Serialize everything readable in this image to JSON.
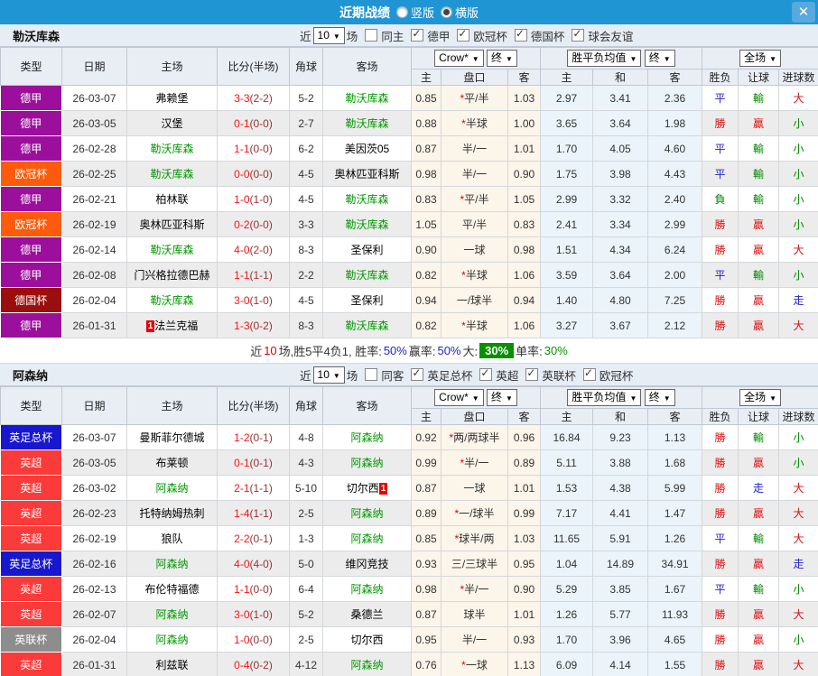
{
  "titlebar": {
    "title": "近期战绩",
    "vertical": "竖版",
    "horizontal": "横版",
    "selected": "horizontal",
    "close": "✕"
  },
  "table_header": {
    "type": "类型",
    "date": "日期",
    "home": "主场",
    "score": "比分(半场)",
    "corners": "角球",
    "away": "客场",
    "book": "Crow*",
    "final": "终",
    "h": "主",
    "pan": "盘口",
    "a": "客",
    "avg": "胜平负均值",
    "avg_final": "终",
    "avg_h": "主",
    "avg_d": "和",
    "avg_a": "客",
    "scope": "全场",
    "result": "胜负",
    "handicap": "让球",
    "goals": "进球数"
  },
  "colors": {
    "titlebar": "#2095d3",
    "red": "#dd1111",
    "green": "#008800",
    "blue": "#2222cc",
    "ft": "#ff1111",
    "ht": "#993333",
    "team": "#009900",
    "league": {
      "德甲": "#9c0f9c",
      "欧冠杯": "#fd5b0b",
      "德国杯": "#9b0e0e",
      "英足总杯": "#1717cf",
      "英超": "#fb3a3a",
      "英联杯": "#8d8d8d"
    }
  },
  "result_colors": {
    "勝": "red",
    "贏": "red",
    "大": "red",
    "平": "blue",
    "走": "blue",
    "負": "green",
    "輸": "green",
    "小": "green"
  },
  "sections": [
    {
      "team": "勒沃库森",
      "filter": {
        "near": "近",
        "count": "10",
        "games": "场",
        "same": {
          "label": "同主",
          "checked": false
        },
        "leagues": [
          {
            "label": "德甲",
            "checked": true
          },
          {
            "label": "欧冠杯",
            "checked": true
          },
          {
            "label": "德国杯",
            "checked": true
          },
          {
            "label": "球会友谊",
            "checked": true
          }
        ]
      },
      "rows": [
        {
          "type": "德甲",
          "date": "26-03-07",
          "home": "弗赖堡",
          "home_team": false,
          "ft": "3-3",
          "ht": "(2-2)",
          "corners": "5-2",
          "away": "勒沃库森",
          "away_team": true,
          "o1": "0.85",
          "pan": "*平/半",
          "o2": "1.03",
          "a1": "2.97",
          "a2": "3.41",
          "a3": "2.36",
          "r1": "平",
          "r2": "輸",
          "r3": "大"
        },
        {
          "type": "德甲",
          "date": "26-03-05",
          "home": "汉堡",
          "home_team": false,
          "ft": "0-1",
          "ht": "(0-0)",
          "corners": "2-7",
          "away": "勒沃库森",
          "away_team": true,
          "o1": "0.88",
          "pan": "*半球",
          "o2": "1.00",
          "a1": "3.65",
          "a2": "3.64",
          "a3": "1.98",
          "r1": "勝",
          "r2": "贏",
          "r3": "小"
        },
        {
          "type": "德甲",
          "date": "26-02-28",
          "home": "勒沃库森",
          "home_team": true,
          "ft": "1-1",
          "ht": "(0-0)",
          "corners": "6-2",
          "away": "美因茨05",
          "away_team": false,
          "o1": "0.87",
          "pan": "半/一",
          "o2": "1.01",
          "a1": "1.70",
          "a2": "4.05",
          "a3": "4.60",
          "r1": "平",
          "r2": "輸",
          "r3": "小"
        },
        {
          "type": "欧冠杯",
          "date": "26-02-25",
          "home": "勒沃库森",
          "home_team": true,
          "ft": "0-0",
          "ht": "(0-0)",
          "corners": "4-5",
          "away": "奥林匹亚科斯",
          "away_team": false,
          "o1": "0.98",
          "pan": "半/一",
          "o2": "0.90",
          "a1": "1.75",
          "a2": "3.98",
          "a3": "4.43",
          "r1": "平",
          "r2": "輸",
          "r3": "小"
        },
        {
          "type": "德甲",
          "date": "26-02-21",
          "home": "柏林联",
          "home_team": false,
          "ft": "1-0",
          "ht": "(1-0)",
          "corners": "4-5",
          "away": "勒沃库森",
          "away_team": true,
          "o1": "0.83",
          "pan": "*平/半",
          "o2": "1.05",
          "a1": "2.99",
          "a2": "3.32",
          "a3": "2.40",
          "r1": "負",
          "r2": "輸",
          "r3": "小"
        },
        {
          "type": "欧冠杯",
          "date": "26-02-19",
          "home": "奥林匹亚科斯",
          "home_team": false,
          "ft": "0-2",
          "ht": "(0-0)",
          "corners": "3-3",
          "away": "勒沃库森",
          "away_team": true,
          "o1": "1.05",
          "pan": "平/半",
          "o2": "0.83",
          "a1": "2.41",
          "a2": "3.34",
          "a3": "2.99",
          "r1": "勝",
          "r2": "贏",
          "r3": "小"
        },
        {
          "type": "德甲",
          "date": "26-02-14",
          "home": "勒沃库森",
          "home_team": true,
          "ft": "4-0",
          "ht": "(2-0)",
          "corners": "8-3",
          "away": "圣保利",
          "away_team": false,
          "o1": "0.90",
          "pan": "一球",
          "o2": "0.98",
          "a1": "1.51",
          "a2": "4.34",
          "a3": "6.24",
          "r1": "勝",
          "r2": "贏",
          "r3": "大"
        },
        {
          "type": "德甲",
          "date": "26-02-08",
          "home": "门兴格拉德巴赫",
          "home_team": false,
          "ft": "1-1",
          "ht": "(1-1)",
          "corners": "2-2",
          "away": "勒沃库森",
          "away_team": true,
          "o1": "0.82",
          "pan": "*半球",
          "o2": "1.06",
          "a1": "3.59",
          "a2": "3.64",
          "a3": "2.00",
          "r1": "平",
          "r2": "輸",
          "r3": "小"
        },
        {
          "type": "德国杯",
          "date": "26-02-04",
          "home": "勒沃库森",
          "home_team": true,
          "ft": "3-0",
          "ht": "(1-0)",
          "corners": "4-5",
          "away": "圣保利",
          "away_team": false,
          "o1": "0.94",
          "pan": "一/球半",
          "o2": "0.94",
          "a1": "1.40",
          "a2": "4.80",
          "a3": "7.25",
          "r1": "勝",
          "r2": "贏",
          "r3": "走"
        },
        {
          "type": "德甲",
          "date": "26-01-31",
          "home": "法兰克福",
          "home_team": false,
          "home_rank": "1",
          "home_rank_pos": "before",
          "ft": "1-3",
          "ht": "(0-2)",
          "corners": "8-3",
          "away": "勒沃库森",
          "away_team": true,
          "o1": "0.82",
          "pan": "*半球",
          "o2": "1.06",
          "a1": "3.27",
          "a2": "3.67",
          "a3": "2.12",
          "r1": "勝",
          "r2": "贏",
          "r3": "大"
        }
      ],
      "summary_parts": [
        {
          "t": "近",
          "c": "dark"
        },
        {
          "t": "10",
          "c": "red"
        },
        {
          "t": "场,胜5平4负1, 胜率:",
          "c": "dark"
        },
        {
          "t": "50%",
          "c": "blue"
        },
        {
          "t": " 赢率:",
          "c": "dark"
        },
        {
          "t": "50%",
          "c": "blue"
        },
        {
          "t": " 大: ",
          "c": "dark"
        },
        {
          "t": "30%",
          "c": "bigbox"
        },
        {
          "t": " 单率:",
          "c": "dark"
        },
        {
          "t": "30%",
          "c": "green"
        }
      ]
    },
    {
      "team": "阿森纳",
      "filter": {
        "near": "近",
        "count": "10",
        "games": "场",
        "same": {
          "label": "同客",
          "checked": false
        },
        "leagues": [
          {
            "label": "英足总杯",
            "checked": true
          },
          {
            "label": "英超",
            "checked": true
          },
          {
            "label": "英联杯",
            "checked": true
          },
          {
            "label": "欧冠杯",
            "checked": true
          }
        ]
      },
      "rows": [
        {
          "type": "英足总杯",
          "date": "26-03-07",
          "home": "曼斯菲尔德城",
          "home_team": false,
          "ft": "1-2",
          "ht": "(0-1)",
          "corners": "4-8",
          "away": "阿森纳",
          "away_team": true,
          "o1": "0.92",
          "pan": "*两/两球半",
          "o2": "0.96",
          "a1": "16.84",
          "a2": "9.23",
          "a3": "1.13",
          "r1": "勝",
          "r2": "輸",
          "r3": "小"
        },
        {
          "type": "英超",
          "date": "26-03-05",
          "home": "布莱顿",
          "home_team": false,
          "ft": "0-1",
          "ht": "(0-1)",
          "corners": "4-3",
          "away": "阿森纳",
          "away_team": true,
          "o1": "0.99",
          "pan": "*半/一",
          "o2": "0.89",
          "a1": "5.11",
          "a2": "3.88",
          "a3": "1.68",
          "r1": "勝",
          "r2": "贏",
          "r3": "小"
        },
        {
          "type": "英超",
          "date": "26-03-02",
          "home": "阿森纳",
          "home_team": true,
          "ft": "2-1",
          "ht": "(1-1)",
          "corners": "5-10",
          "away": "切尔西",
          "away_team": false,
          "away_rank": "1",
          "away_rank_pos": "after",
          "o1": "0.87",
          "pan": "一球",
          "o2": "1.01",
          "a1": "1.53",
          "a2": "4.38",
          "a3": "5.99",
          "r1": "勝",
          "r2": "走",
          "r3": "大"
        },
        {
          "type": "英超",
          "date": "26-02-23",
          "home": "托特纳姆热刺",
          "home_team": false,
          "ft": "1-4",
          "ht": "(1-1)",
          "corners": "2-5",
          "away": "阿森纳",
          "away_team": true,
          "o1": "0.89",
          "pan": "*一/球半",
          "o2": "0.99",
          "a1": "7.17",
          "a2": "4.41",
          "a3": "1.47",
          "r1": "勝",
          "r2": "贏",
          "r3": "大"
        },
        {
          "type": "英超",
          "date": "26-02-19",
          "home": "狼队",
          "home_team": false,
          "ft": "2-2",
          "ht": "(0-1)",
          "corners": "1-3",
          "away": "阿森纳",
          "away_team": true,
          "o1": "0.85",
          "pan": "*球半/两",
          "o2": "1.03",
          "a1": "11.65",
          "a2": "5.91",
          "a3": "1.26",
          "r1": "平",
          "r2": "輸",
          "r3": "大"
        },
        {
          "type": "英足总杯",
          "date": "26-02-16",
          "home": "阿森纳",
          "home_team": true,
          "ft": "4-0",
          "ht": "(4-0)",
          "corners": "5-0",
          "away": "维冈竞技",
          "away_team": false,
          "o1": "0.93",
          "pan": "三/三球半",
          "o2": "0.95",
          "a1": "1.04",
          "a2": "14.89",
          "a3": "34.91",
          "r1": "勝",
          "r2": "贏",
          "r3": "走"
        },
        {
          "type": "英超",
          "date": "26-02-13",
          "home": "布伦特福德",
          "home_team": false,
          "ft": "1-1",
          "ht": "(0-0)",
          "corners": "6-4",
          "away": "阿森纳",
          "away_team": true,
          "o1": "0.98",
          "pan": "*半/一",
          "o2": "0.90",
          "a1": "5.29",
          "a2": "3.85",
          "a3": "1.67",
          "r1": "平",
          "r2": "輸",
          "r3": "小"
        },
        {
          "type": "英超",
          "date": "26-02-07",
          "home": "阿森纳",
          "home_team": true,
          "ft": "3-0",
          "ht": "(1-0)",
          "corners": "5-2",
          "away": "桑德兰",
          "away_team": false,
          "o1": "0.87",
          "pan": "球半",
          "o2": "1.01",
          "a1": "1.26",
          "a2": "5.77",
          "a3": "11.93",
          "r1": "勝",
          "r2": "贏",
          "r3": "大"
        },
        {
          "type": "英联杯",
          "date": "26-02-04",
          "home": "阿森纳",
          "home_team": true,
          "ft": "1-0",
          "ht": "(0-0)",
          "corners": "2-5",
          "away": "切尔西",
          "away_team": false,
          "o1": "0.95",
          "pan": "半/一",
          "o2": "0.93",
          "a1": "1.70",
          "a2": "3.96",
          "a3": "4.65",
          "r1": "勝",
          "r2": "贏",
          "r3": "小"
        },
        {
          "type": "英超",
          "date": "26-01-31",
          "home": "利兹联",
          "home_team": false,
          "ft": "0-4",
          "ht": "(0-2)",
          "corners": "4-12",
          "away": "阿森纳",
          "away_team": true,
          "o1": "0.76",
          "pan": "*一球",
          "o2": "1.13",
          "a1": "6.09",
          "a2": "4.14",
          "a3": "1.55",
          "r1": "勝",
          "r2": "贏",
          "r3": "大"
        }
      ]
    }
  ]
}
